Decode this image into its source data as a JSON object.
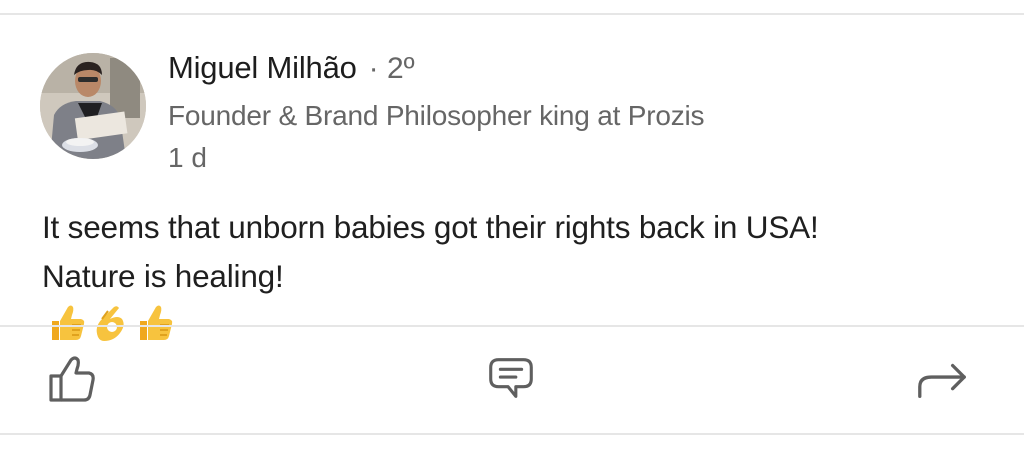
{
  "post": {
    "author": {
      "name": "Miguel Milhão",
      "degree": "· 2º",
      "headline": "Founder & Brand Philosopher king at Prozis",
      "time_ago": "1 d"
    },
    "text_line1": "It seems that unborn babies got their rights back in USA!",
    "text_line2": "Nature is healing!",
    "emojis": [
      "thumbs-up",
      "ok-hand",
      "thumbs-up"
    ]
  },
  "actions": {
    "like_icon": "thumbs-up-icon",
    "comment_icon": "comment-icon",
    "share_icon": "share-arrow-icon"
  },
  "colors": {
    "text_primary": "#1f1f1f",
    "text_secondary": "#666666",
    "divider": "#e6e6e6",
    "icon": "#5f5f5f",
    "emoji": "#f5c242"
  }
}
